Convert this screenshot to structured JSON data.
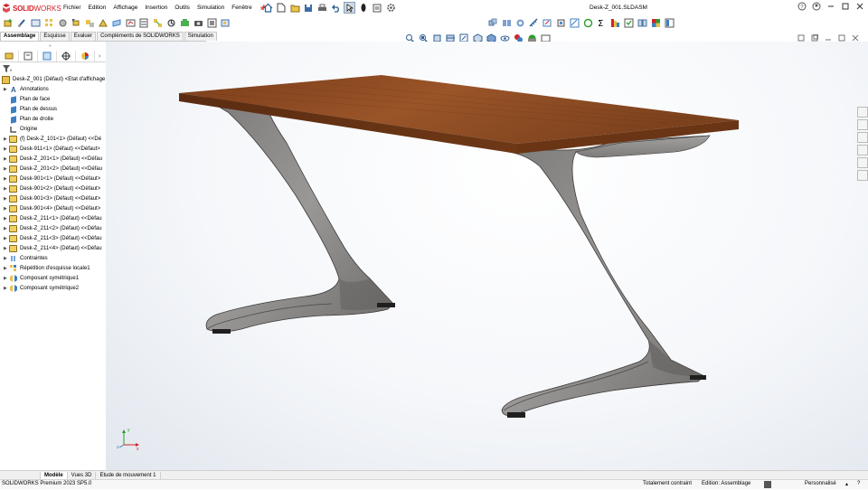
{
  "app": {
    "brand_bold": "SOLID",
    "brand_rest": "WORKS",
    "document_title": "Desk-Z_001.SLDASM"
  },
  "menu": [
    "Fichier",
    "Edition",
    "Affichage",
    "Insertion",
    "Outils",
    "Simulation",
    "Fenêtre"
  ],
  "tabs": [
    "Assemblage",
    "Esquisse",
    "Evaluer",
    "Compléments de SOLIDWORKS",
    "Simulation"
  ],
  "tree": {
    "root": "Desk-Z_001 (Défaut) <Etat d'affichage",
    "items": [
      {
        "label": "Annotations",
        "icon": "annotations-icon"
      },
      {
        "label": "Plan de face",
        "icon": "plane-icon"
      },
      {
        "label": "Plan de dessus",
        "icon": "plane-icon"
      },
      {
        "label": "Plan de droite",
        "icon": "plane-icon"
      },
      {
        "label": "Origine",
        "icon": "origin-icon"
      },
      {
        "label": "(f) Desk-Z_101<1> (Défaut) <<Dé",
        "icon": "part-icon"
      },
      {
        "label": "Desk-911<1> (Défaut) <<Défaut>",
        "icon": "part-icon"
      },
      {
        "label": "Desk-Z_201<1> (Défaut) <<Défau",
        "icon": "part-icon"
      },
      {
        "label": "Desk-Z_201<2> (Défaut) <<Défau",
        "icon": "part-icon"
      },
      {
        "label": "Desk-901<1> (Défaut) <<Défaut>",
        "icon": "part-icon"
      },
      {
        "label": "Desk-901<2> (Défaut) <<Défaut>",
        "icon": "part-icon"
      },
      {
        "label": "Desk-901<3> (Défaut) <<Défaut>",
        "icon": "part-icon"
      },
      {
        "label": "Desk-901<4> (Défaut) <<Défaut>",
        "icon": "part-icon"
      },
      {
        "label": "Desk-Z_211<1> (Défaut) <<Défau",
        "icon": "part-icon"
      },
      {
        "label": "Desk-Z_211<2> (Défaut) <<Défau",
        "icon": "part-icon"
      },
      {
        "label": "Desk-Z_211<3> (Défaut) <<Défau",
        "icon": "part-icon"
      },
      {
        "label": "Desk-Z_211<4> (Défaut) <<Défau",
        "icon": "part-icon"
      },
      {
        "label": "Contraintes",
        "icon": "mates-icon"
      },
      {
        "label": "Répétition d'esquisse locale1",
        "icon": "pattern-icon"
      },
      {
        "label": "Composant symétrique1",
        "icon": "mirror-icon"
      },
      {
        "label": "Composant symétrique2",
        "icon": "mirror-icon"
      }
    ]
  },
  "bottom_tabs": [
    "Modèle",
    "Vues 3D",
    "Etude de mouvement 1"
  ],
  "status": {
    "product": "SOLIDWORKS Premium 2023 SP5.0",
    "constraint": "Totalement contraint",
    "edit_mode": "Edition: Assemblage",
    "units": "Personnalisé"
  },
  "colors": {
    "brand_red": "#d2232a",
    "wood": "#8a4a22",
    "metal": "#8c8a87"
  }
}
